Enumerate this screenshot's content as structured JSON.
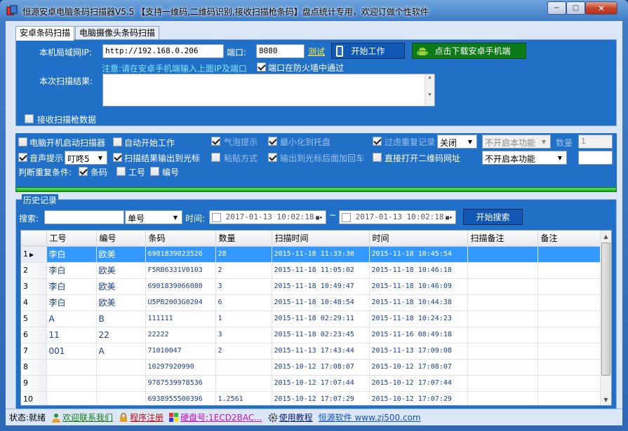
{
  "window": {
    "title": "恒源安卓电脑条码扫描器V5.5 【支持一维码,二维码识别,接收扫描枪条码】盘点统计专用，欢迎订做个性软件",
    "min_glyph": "−",
    "max_glyph": "□",
    "close_glyph": "✕"
  },
  "tabs": [
    {
      "label": "安卓条码扫描"
    },
    {
      "label": "电脑摄像头条码扫描"
    }
  ],
  "scan_panel": {
    "ip_label": "本机局域网IP:",
    "ip_value": "http://192.168.0.206",
    "port_label": "端口:",
    "port_value": "8080",
    "test_link": "测试",
    "start_button": "开始工作",
    "download_button": "点击下载安卓手机端",
    "note": "注意:请在安卓手机端输入上面IP及端口",
    "firewall_label": "端口在防火墙中通过",
    "result_label": "本次扫描结果:",
    "receive_gun_label": "接收扫描枪数据"
  },
  "options": {
    "autostart_label": "电脑开机启动扫描器",
    "autowork_label": "自动开始工作",
    "bubble_label": "气泡提示",
    "tray_label": "最小化到托盘",
    "filter_dup_label": "过虑重复记录",
    "filter_dup_value": "关闭",
    "func1_value": "不开启本功能",
    "qty_label": "数量",
    "qty_value": "1",
    "sound_label": "音声提示",
    "sound_value": "叮咚5",
    "output_cursor_label": "扫描结果输出到光标",
    "paste_label": "粘贴方式",
    "enter_label": "输出到光标后面加回车",
    "open_url_label": "直接打开二维码网址",
    "func2_value": "不开启本功能",
    "dup_cond_label": "判断重复条件:",
    "cond_barcode": "条码",
    "cond_worker": "工号",
    "cond_code": "编号"
  },
  "history": {
    "legend": "历史记录",
    "search_label": "搜索:",
    "field_value": "单号",
    "time_label": "时间:",
    "date_from": "2017-01-13  10:02:18",
    "date_sep": "~",
    "date_to": "2017-01-13  10:02:18",
    "search_button": "开始搜索",
    "columns": [
      "工号",
      "编号",
      "条码",
      "数量",
      "扫描时间",
      "时间",
      "扫描备注",
      "备注"
    ],
    "rows": [
      {
        "n": "1",
        "c": [
          "李白",
          "欧美",
          "6901839023526",
          "28",
          "2015-11-18 11:33:30",
          "2015-11-18 10:45:54",
          "",
          ""
        ]
      },
      {
        "n": "2",
        "c": [
          "李白",
          "欧美",
          "F5RB6331V0103",
          "2",
          "2015-11-18 11:05:02",
          "2015-11-18 10:46:18",
          "",
          ""
        ]
      },
      {
        "n": "3",
        "c": [
          "李白",
          "欧美",
          "6901839066080",
          "3",
          "2015-11-18 10:49:47",
          "2015-11-18 10:46:09",
          "",
          ""
        ]
      },
      {
        "n": "4",
        "c": [
          "李白",
          "欧美",
          "U5PB2003G0204",
          "6",
          "2015-11-18 10:48:54",
          "2015-11-18 10:44:38",
          "",
          ""
        ]
      },
      {
        "n": "5",
        "c": [
          "A",
          "B",
          "111111",
          "1",
          "2015-11-18 02:29:11",
          "2015-11-18 10:24:23",
          "",
          ""
        ]
      },
      {
        "n": "6",
        "c": [
          "11",
          "22",
          "22222",
          "3",
          "2015-11-18 02:23:45",
          "2015-11-16 08:49:18",
          "",
          ""
        ]
      },
      {
        "n": "7",
        "c": [
          "001",
          "A",
          "71010047",
          "2",
          "2015-11-13 17:43:44",
          "2015-11-13 17:09:08",
          "",
          ""
        ]
      },
      {
        "n": "8",
        "c": [
          "",
          "",
          "10297920990",
          "",
          "2015-10-12 17:08:07",
          "2015-10-12 17:08:07",
          "",
          ""
        ]
      },
      {
        "n": "9",
        "c": [
          "",
          "",
          "9787539978536",
          "",
          "2015-10-12 17:07:44",
          "2015-10-12 17:07:44",
          "",
          ""
        ]
      },
      {
        "n": "10",
        "c": [
          "",
          "",
          "6938955500396",
          "1.2561",
          "2015-10-12 17:07:29",
          "2015-10-12 17:07:29",
          "",
          ""
        ]
      }
    ]
  },
  "status": {
    "state": "状态:就绪",
    "contact": "欢迎联系我们",
    "register": "程序注册",
    "disk": "硬盘号:1ECD2BAC...",
    "tutorial": "使用教程",
    "site": "恒源软件 www.zj500.com"
  },
  "colors": {
    "panel_blue": "#2170c8",
    "title_blue": "#3f7cc6",
    "selected_row": "#3399ff",
    "link_yellow": "#ffef40"
  }
}
